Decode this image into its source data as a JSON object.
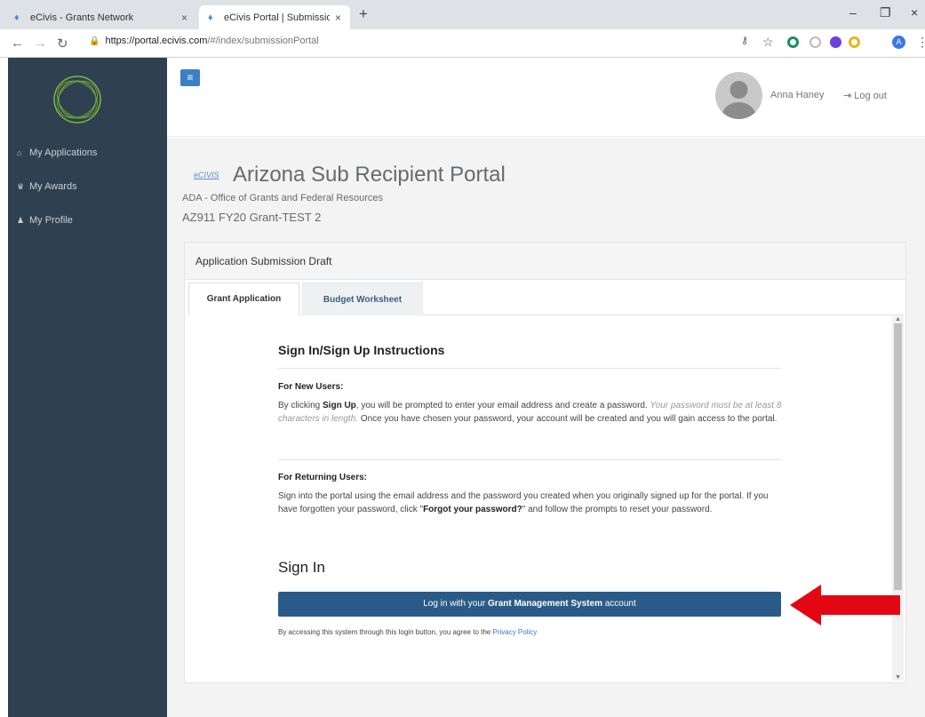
{
  "browser": {
    "tabs": [
      {
        "title": "eCivis - Grants Network",
        "close": "×"
      },
      {
        "title": "eCivis Portal | Submission Portal",
        "close": "×"
      }
    ],
    "new_tab": "+",
    "window_controls": {
      "minimize": "–",
      "restore": "❐",
      "close": "×"
    },
    "url_host": "https://portal.ecivis.com",
    "url_path": "/#/index/submissionPortal",
    "profile_initial": "A"
  },
  "sidebar": {
    "items": [
      {
        "label": "My Applications",
        "icon": "home-icon"
      },
      {
        "label": "My Awards",
        "icon": "trophy-icon"
      },
      {
        "label": "My Profile",
        "icon": "user-icon"
      }
    ]
  },
  "header": {
    "user_name": "Anna Haney",
    "logout_label": "Log out"
  },
  "main": {
    "brand_mark": "eCIVIS",
    "portal_title": "Arizona Sub Recipient Portal",
    "organization": "ADA - Office of Grants and Federal Resources",
    "grant_name": "AZ911 FY20 Grant-TEST 2",
    "panel_title": "Application Submission Draft",
    "tabs": [
      "Grant Application",
      "Budget Worksheet"
    ]
  },
  "instructions": {
    "title": "Sign In/Sign Up Instructions",
    "new_users_heading": "For New Users:",
    "new_users_p1": "By clicking ",
    "new_users_bold": "Sign Up",
    "new_users_p2": ", you will be prompted to enter your email address and create a password. ",
    "new_users_em": "Your password must be at least 8 characters in length.",
    "new_users_p3": " Once you have chosen your password, your account will be created and you will gain access to the portal.",
    "returning_heading": "For Returning Users:",
    "returning_p1": "Sign into the portal using the email address and the password you created when you originally signed up for the portal. If you have forgotten your password, click \"",
    "returning_bold": "Forgot your password?",
    "returning_p2": "\" and follow the prompts to reset your password.",
    "sign_in_heading": "Sign In",
    "login_prefix": "Log in with your ",
    "login_bold": "Grant Management System",
    "login_suffix": " account",
    "legal_text": "By accessing this system through this login button, you agree to the ",
    "privacy_link": "Privacy Policy"
  },
  "colors": {
    "sidebar_bg": "#2f4050",
    "button_bg": "#2a5b88",
    "arrow": "#e30613",
    "accent": "#3b7fc4"
  }
}
